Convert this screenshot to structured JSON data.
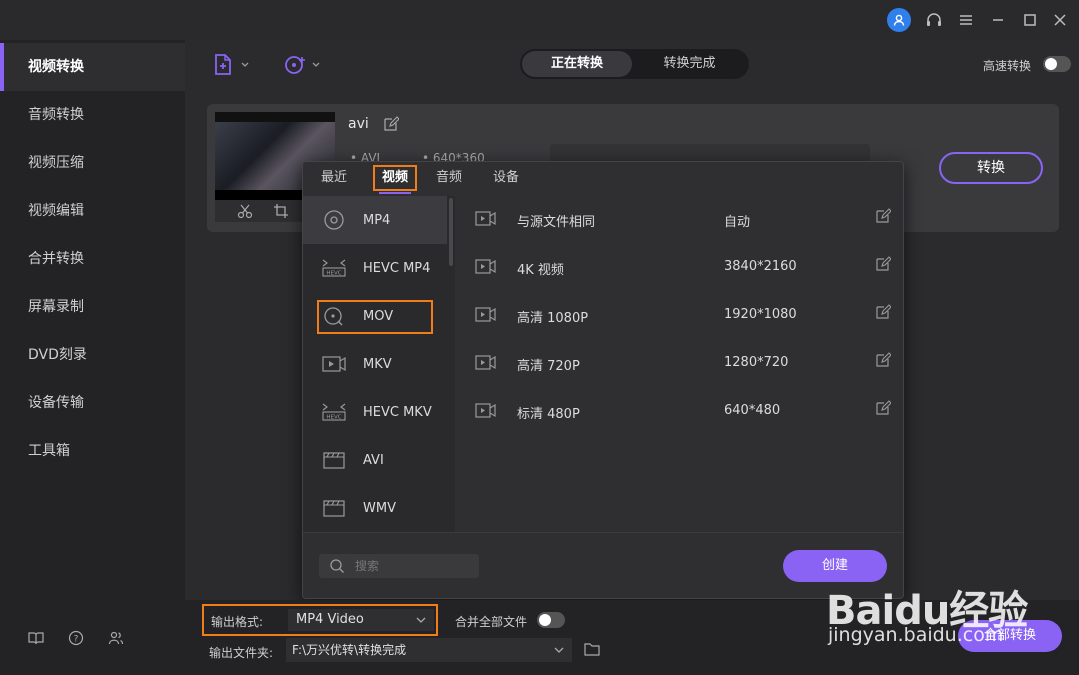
{
  "sidebar": {
    "items": [
      {
        "label": "视频转换",
        "active": true
      },
      {
        "label": "音频转换"
      },
      {
        "label": "视频压缩"
      },
      {
        "label": "视频编辑"
      },
      {
        "label": "合并转换"
      },
      {
        "label": "屏幕录制"
      },
      {
        "label": "DVD刻录"
      },
      {
        "label": "设备传输"
      },
      {
        "label": "工具箱"
      }
    ]
  },
  "toolbar": {
    "tabs": [
      "正在转换",
      "转换完成"
    ],
    "fast_convert_label": "高速转换",
    "fast_convert_on": false
  },
  "file_card": {
    "name": "avi",
    "format": "AVI",
    "resolution": "640*360",
    "convert_label": "转换"
  },
  "format_panel": {
    "tabs": [
      "最近",
      "视频",
      "音频",
      "设备"
    ],
    "active_tab": "视频",
    "formats": [
      {
        "label": "MP4",
        "icon": "disc-icon"
      },
      {
        "label": "HEVC MP4",
        "icon": "hevc-icon"
      },
      {
        "label": "MOV",
        "icon": "quicktime-icon"
      },
      {
        "label": "MKV",
        "icon": "video-file-icon"
      },
      {
        "label": "HEVC MKV",
        "icon": "hevc-icon"
      },
      {
        "label": "AVI",
        "icon": "clapper-icon"
      },
      {
        "label": "WMV",
        "icon": "clapper-icon"
      }
    ],
    "presets": [
      {
        "name": "与源文件相同",
        "resolution": "自动"
      },
      {
        "name": "4K 视频",
        "resolution": "3840*2160"
      },
      {
        "name": "高清 1080P",
        "resolution": "1920*1080"
      },
      {
        "name": "高清 720P",
        "resolution": "1280*720"
      },
      {
        "name": "标清 480P",
        "resolution": "640*480"
      }
    ],
    "search_placeholder": "搜索",
    "create_label": "创建"
  },
  "bottom_bar": {
    "output_format_label": "输出格式:",
    "output_format_value": "MP4 Video",
    "merge_label": "合并全部文件",
    "merge_on": false,
    "output_folder_label": "输出文件夹:",
    "output_folder_value": "F:\\万兴优转\\转换完成",
    "convert_all_label": "全部转换"
  },
  "watermark": {
    "logo": "Baidu经验",
    "url": "jingyan.baidu.com"
  },
  "colors": {
    "accent": "#8a63f5",
    "highlight_box": "#f07c1a"
  }
}
